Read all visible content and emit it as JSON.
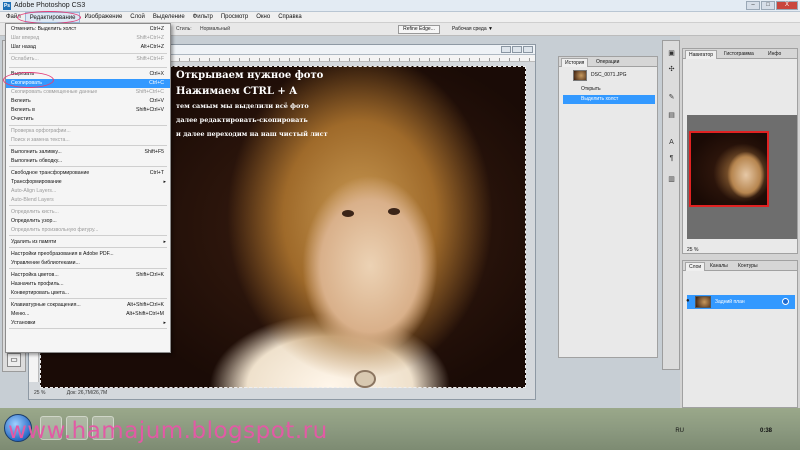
{
  "window": {
    "title": "Adobe Photoshop CS3",
    "close_label": "X"
  },
  "menubar": [
    "Файл",
    "Редактирование",
    "Изображение",
    "Слой",
    "Выделение",
    "Фильтр",
    "Просмотр",
    "Окно",
    "Справка"
  ],
  "options": {
    "style_label": "Стиль:",
    "style_value": "Нормальный",
    "refine_edge": "Refine Edge...",
    "workspace": "Рабочая среда ▼"
  },
  "edit_menu": [
    {
      "label": "Отменить: Выделить холст",
      "shortcut": "Ctrl+Z",
      "state": "normal"
    },
    {
      "label": "Шаг вперед",
      "shortcut": "Shift+Ctrl+Z",
      "state": "disabled"
    },
    {
      "label": "Шаг назад",
      "shortcut": "Alt+Ctrl+Z",
      "state": "normal"
    },
    {
      "label": "Ослабить...",
      "shortcut": "Shift+Ctrl+F",
      "state": "disabled"
    },
    {
      "label": "Вырезать",
      "shortcut": "Ctrl+X",
      "state": "normal"
    },
    {
      "label": "Скопировать",
      "shortcut": "Ctrl+C",
      "state": "highlight"
    },
    {
      "label": "Скопировать совмещенные данные",
      "shortcut": "Shift+Ctrl+C",
      "state": "disabled"
    },
    {
      "label": "Вклеить",
      "shortcut": "Ctrl+V",
      "state": "normal"
    },
    {
      "label": "Вклеить в",
      "shortcut": "Shift+Ctrl+V",
      "state": "normal"
    },
    {
      "label": "Очистить",
      "shortcut": "",
      "state": "normal"
    },
    {
      "label": "Проверка орфографии...",
      "shortcut": "",
      "state": "disabled"
    },
    {
      "label": "Поиск и замена текста...",
      "shortcut": "",
      "state": "disabled"
    },
    {
      "label": "Выполнить заливку...",
      "shortcut": "Shift+F5",
      "state": "normal"
    },
    {
      "label": "Выполнить обводку...",
      "shortcut": "",
      "state": "normal"
    },
    {
      "label": "Свободное трансформирование",
      "shortcut": "Ctrl+T",
      "state": "normal"
    },
    {
      "label": "Трансформирование",
      "shortcut": "",
      "state": "sub"
    },
    {
      "label": "Auto-Align Layers...",
      "shortcut": "",
      "state": "disabled"
    },
    {
      "label": "Auto-Blend Layers",
      "shortcut": "",
      "state": "disabled"
    },
    {
      "label": "Определить кисть...",
      "shortcut": "",
      "state": "disabled"
    },
    {
      "label": "Определить узор...",
      "shortcut": "",
      "state": "normal"
    },
    {
      "label": "Определить произвольную фигуру...",
      "shortcut": "",
      "state": "disabled"
    },
    {
      "label": "Удалить из памяти",
      "shortcut": "",
      "state": "sub"
    },
    {
      "label": "Настройки преобразования в Adobe PDF...",
      "shortcut": "",
      "state": "normal"
    },
    {
      "label": "Управление библиотеками...",
      "shortcut": "",
      "state": "normal"
    },
    {
      "label": "Настройка цветов...",
      "shortcut": "Shift+Ctrl+K",
      "state": "normal"
    },
    {
      "label": "Назначить профиль...",
      "shortcut": "",
      "state": "normal"
    },
    {
      "label": "Конвертировать цвета...",
      "shortcut": "",
      "state": "normal"
    },
    {
      "label": "Клавиатурные сокращения...",
      "shortcut": "Alt+Shift+Ctrl+K",
      "state": "normal"
    },
    {
      "label": "Меню...",
      "shortcut": "Alt+Shift+Ctrl+M",
      "state": "normal"
    },
    {
      "label": "Установки",
      "shortcut": "",
      "state": "sub"
    }
  ],
  "overlay": {
    "line1": "Открываем нужное фото",
    "line2": "Нажимаем CTRL + A",
    "line3": "тем самым мы выделили всё фото",
    "line4": "далее редактировать-скопировать",
    "line5": "и далее переходим на наш чистый лист"
  },
  "document_status": {
    "zoom": "25 %",
    "size": "Док: 26,7M/26,7M"
  },
  "history": {
    "tabs": [
      "История",
      "Операции"
    ],
    "snapshot": "DSC_0071.JPG",
    "items": [
      "Открыть",
      "Выделить холст"
    ]
  },
  "navigator": {
    "tabs": [
      "Навигатор",
      "Гистограмма",
      "Инфо"
    ],
    "zoom": "25 %"
  },
  "layers": {
    "tabs": [
      "Слои",
      "Каналы",
      "Контуры"
    ],
    "layer_name": "Задний план"
  },
  "taskbar": {
    "watermark": "www.hamajum.blogspot.ru",
    "lang": "RU",
    "time": "0:38"
  },
  "colors": {
    "highlight": "#3399ff",
    "annotation": "#e3407b",
    "watermark": "#e25aa5"
  }
}
